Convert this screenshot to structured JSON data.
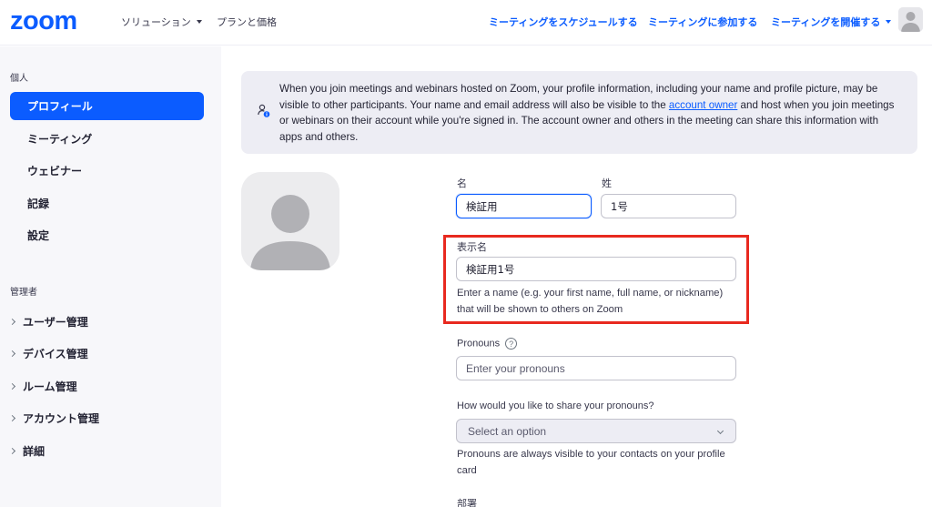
{
  "header": {
    "logo": "zoom",
    "nav_left": [
      {
        "label": "ソリューション",
        "has_caret": true
      },
      {
        "label": "プランと価格",
        "has_caret": false
      }
    ],
    "nav_right": [
      {
        "label": "ミーティングをスケジュールする",
        "has_caret": false
      },
      {
        "label": "ミーティングに参加する",
        "has_caret": false
      },
      {
        "label": "ミーティングを開催する",
        "has_caret": true
      }
    ]
  },
  "sidebar": {
    "section_personal": "個人",
    "personal_items": [
      {
        "label": "プロフィール",
        "active": true
      },
      {
        "label": "ミーティング",
        "active": false
      },
      {
        "label": "ウェビナー",
        "active": false
      },
      {
        "label": "記録",
        "active": false
      },
      {
        "label": "設定",
        "active": false
      }
    ],
    "section_admin": "管理者",
    "admin_items": [
      {
        "label": "ユーザー管理"
      },
      {
        "label": "デバイス管理"
      },
      {
        "label": "ルーム管理"
      },
      {
        "label": "アカウント管理"
      },
      {
        "label": "詳細"
      }
    ]
  },
  "banner": {
    "text_before_link": "When you join meetings and webinars hosted on Zoom, your profile information, including your name and profile picture, may be visible to other participants. Your name and email address will also be visible to the ",
    "link_text": "account owner",
    "text_after_link": " and host when you join meetings or webinars on their account while you're signed in. The account owner and others in the meeting can share this information with apps and others.",
    "icon": "user-info-icon"
  },
  "form": {
    "first_name_label": "名",
    "first_name_value": "検証用",
    "last_name_label": "姓",
    "last_name_value": "1号",
    "display_name_label": "表示名",
    "display_name_value": "検証用1号",
    "display_name_help": "Enter a name (e.g. your first name, full name, or nickname) that will be shown to others on Zoom",
    "pronouns_label": "Pronouns",
    "pronouns_help_icon": "?",
    "pronouns_placeholder": "Enter your pronouns",
    "share_label": "How would you like to share your pronouns?",
    "share_select_value": "Select an option",
    "share_help": "Pronouns are always visible to your contacts on your profile card",
    "department_label": "部署"
  },
  "colors": {
    "brand": "#0b5cff",
    "highlight": "#e8291f",
    "sidebar_bg": "#f7f7fa",
    "banner_bg": "#ededf4"
  }
}
